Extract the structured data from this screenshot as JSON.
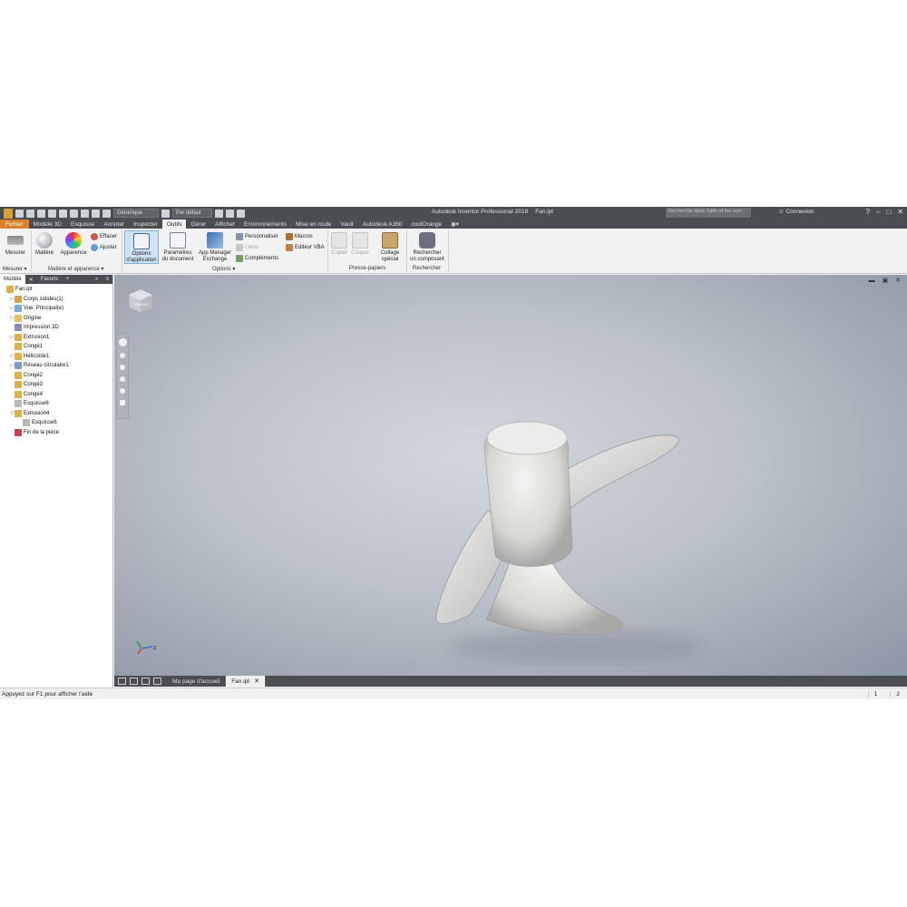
{
  "titlebar": {
    "appearance_select": "Générique",
    "material_select": "Par défaut",
    "app_title": "Autodesk Inventor Professional 2018",
    "doc_title": "Fan.ipt",
    "search_placeholder": "Recherche dans l'aide et les com",
    "connect": "Connexion",
    "help": "?"
  },
  "tabs": [
    "Fichier",
    "Modèle 3D",
    "Esquisse",
    "Annoter",
    "Inspecter",
    "Outils",
    "Gérer",
    "Afficher",
    "Environnements",
    "Mise en route",
    "Vault",
    "Autodesk A360",
    "coolOrange"
  ],
  "ribbon": {
    "measure": "Mesurer",
    "material": "Matière",
    "appearance": "Apparence",
    "clear": "Effacer",
    "adjust": "Ajuster",
    "options_1": "Options",
    "options_2": "d'application",
    "params_1": "Paramètres",
    "params_2": "du document",
    "appmgr_1": "App Manager",
    "appmgr_2": "Exchange",
    "customize": "Personnaliser",
    "links": "Liens",
    "addins": "Compléments",
    "macros": "Macros",
    "vba": "Editeur VBA",
    "copy": "Copier",
    "cut": "Couper",
    "paste_1": "Collage",
    "paste_2": "spécial",
    "find_1": "Rechercher",
    "find_2": "un composant",
    "panel_measure": "Mesurer ▾",
    "panel_material": "Matière et apparence ▾",
    "panel_options": "Options ▾",
    "panel_clipboard": "Presse-papiers",
    "panel_find": "Rechercher"
  },
  "browser": {
    "tab_model": "Modèle",
    "tab_favorites": "Favoris",
    "tree": [
      {
        "label": "Fan.ipt",
        "indent": 0,
        "exp": "",
        "color": "#e0b040"
      },
      {
        "label": "Corps solides(1)",
        "indent": 1,
        "exp": "▷",
        "color": "#d6a54a"
      },
      {
        "label": "Vue: Principal(e)",
        "indent": 1,
        "exp": "▷",
        "color": "#7aa7d8"
      },
      {
        "label": "Origine",
        "indent": 1,
        "exp": "▷",
        "color": "#e8c060"
      },
      {
        "label": "Impression 3D",
        "indent": 1,
        "exp": "",
        "color": "#8a8fb0"
      },
      {
        "label": "Extrusion1",
        "indent": 1,
        "exp": "▷",
        "color": "#e0b040"
      },
      {
        "label": "Congé1",
        "indent": 1,
        "exp": "",
        "color": "#e0b040"
      },
      {
        "label": "Hélicoïde1",
        "indent": 1,
        "exp": "▷",
        "color": "#e0b040"
      },
      {
        "label": "Réseau circulaire1",
        "indent": 1,
        "exp": "▷",
        "color": "#7aa0c8"
      },
      {
        "label": "Congé2",
        "indent": 1,
        "exp": "",
        "color": "#e0b040"
      },
      {
        "label": "Congé3",
        "indent": 1,
        "exp": "",
        "color": "#e0b040"
      },
      {
        "label": "Congé4",
        "indent": 1,
        "exp": "",
        "color": "#e0b040"
      },
      {
        "label": "Esquisse6",
        "indent": 1,
        "exp": "",
        "color": "#b8b8b8"
      },
      {
        "label": "Extrusion4",
        "indent": 1,
        "exp": "▽",
        "color": "#e0b040"
      },
      {
        "label": "Esquisse6",
        "indent": 2,
        "exp": "",
        "color": "#b8b8b8"
      },
      {
        "label": "Fin de la pièce",
        "indent": 1,
        "exp": "",
        "color": "#d04040"
      }
    ]
  },
  "viewport": {
    "viewcube_label": "GAUCHE",
    "triad_z": "Z",
    "window_controls": "▬ ▣ ✕"
  },
  "doctabs": {
    "home": "Ma page d'accueil",
    "file": "Fan.ipt",
    "close": "✕"
  },
  "status": {
    "help_text": "Appuyez sur F1 pour afficher l'aide",
    "num1": "1",
    "num2": "2"
  },
  "colors": {
    "titlebar": "#4a4d51",
    "file_tab": "#d9822b",
    "ribbon": "#f2f2f2",
    "selected_button": "#cfe3f7",
    "model": "#e6e6e3"
  }
}
